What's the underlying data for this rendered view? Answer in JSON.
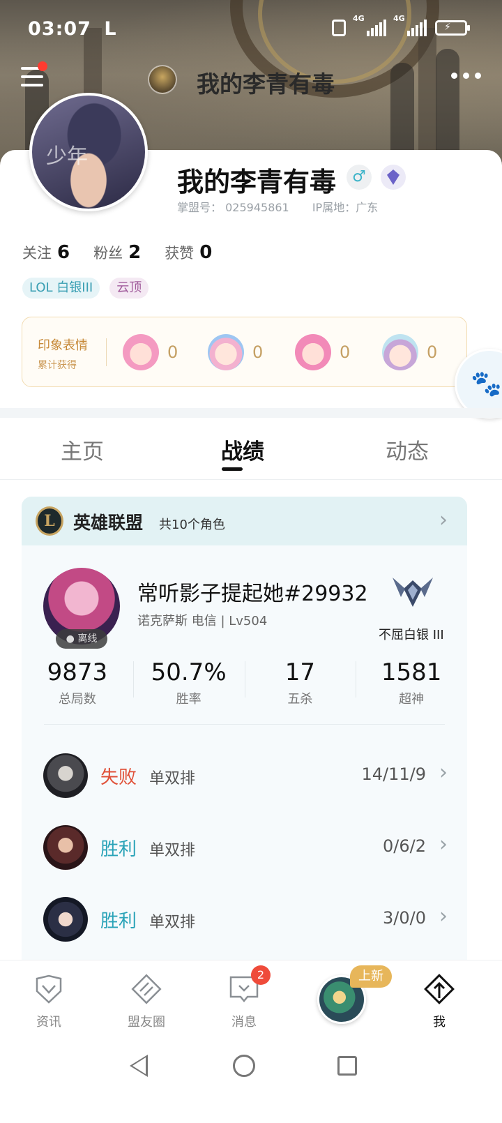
{
  "status_bar": {
    "time": "03:07",
    "carrier_mark": "L",
    "net1": "4G",
    "net2": "4G"
  },
  "header": {
    "title": "我的李青有毒"
  },
  "profile": {
    "name": "我的李青有毒",
    "gender_symbol": "♂",
    "avatar_text": "少年",
    "account_label": "掌盟号：",
    "account_id": "025945861",
    "ip_label": "IP属地：",
    "ip_location": "广东",
    "follow_label": "关注",
    "follow_count": "6",
    "fans_label": "粉丝",
    "fans_count": "2",
    "likes_label": "获赞",
    "likes_count": "0",
    "tags": [
      "LOL 白银III",
      "云顶"
    ]
  },
  "emotes": {
    "title": "印象表情",
    "subtitle": "累计获得",
    "counts": [
      "0",
      "0",
      "0",
      "0"
    ]
  },
  "tabs": [
    "主页",
    "战绩",
    "动态"
  ],
  "active_tab": "战绩",
  "game": {
    "logo_letter": "L",
    "name": "英雄联盟",
    "roles": "共10个角色",
    "summoner": "常听影子提起她#29932",
    "server": "诺克萨斯 电信 | Lv504",
    "status": "离线",
    "rank": "不屈白银 III",
    "kpis": [
      {
        "value": "9873",
        "label": "总局数"
      },
      {
        "value": "50.7%",
        "label": "胜率"
      },
      {
        "value": "17",
        "label": "五杀"
      },
      {
        "value": "1581",
        "label": "超神"
      }
    ],
    "matches": [
      {
        "result": "失败",
        "mode": "单双排",
        "kda": "14/11/9"
      },
      {
        "result": "胜利",
        "mode": "单双排",
        "kda": "0/6/2"
      },
      {
        "result": "胜利",
        "mode": "单双排",
        "kda": "3/0/0"
      }
    ]
  },
  "bottom_nav": {
    "items": [
      "资讯",
      "盟友圈",
      "消息",
      "我"
    ],
    "message_badge": "2",
    "new_tag": "上新"
  },
  "colors": {
    "accent": "#2aa3b8",
    "lose": "#e05038",
    "gold": "#c7a461"
  }
}
